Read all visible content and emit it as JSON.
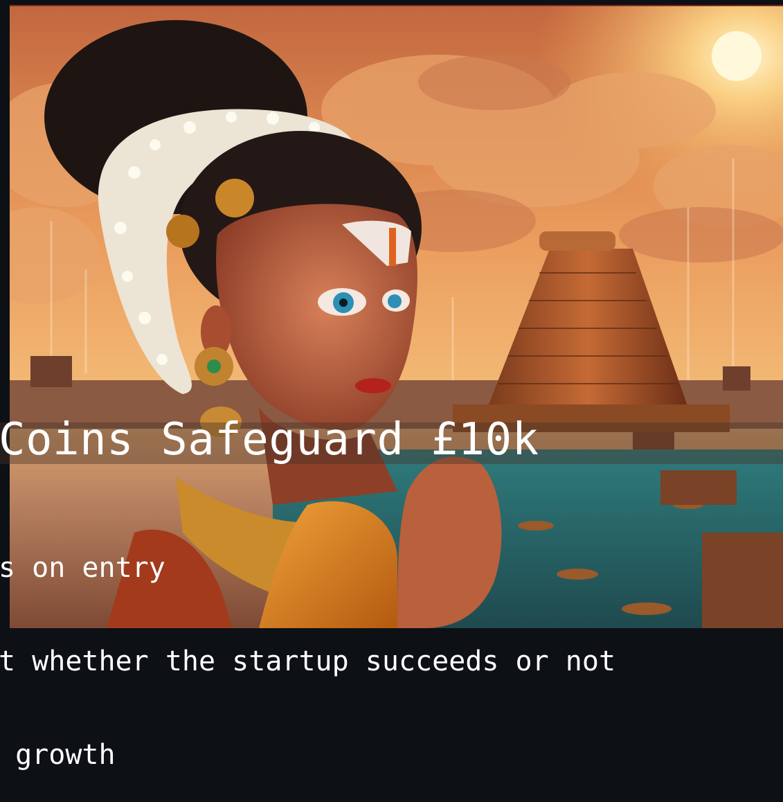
{
  "slide": {
    "title": "Coins Safeguard £10k",
    "lines": [
      "s on entry",
      "t whether the startup succeeds or not",
      " growth"
    ]
  },
  "image": {
    "subject": "temple-illustration",
    "colors": {
      "sky_top": "#d9824a",
      "sky_glow": "#f7c877",
      "sun": "#fff4c9",
      "hair": "#1e1513",
      "skin": "#b25a3c",
      "temple": "#a2542c",
      "water": "#3f8a86",
      "sari": "#e58a1e"
    }
  }
}
